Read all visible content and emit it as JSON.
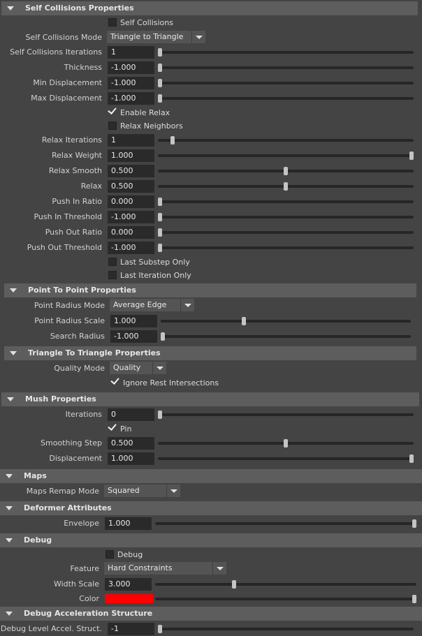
{
  "colors": {
    "accent_color": "#ff0000"
  },
  "sections": {
    "self_collisions": "Self Collisions Properties",
    "point_to_point": "Point To Point Properties",
    "tri_to_tri": "Triangle To Triangle Properties",
    "mush": "Mush Properties",
    "maps": "Maps",
    "deformer": "Deformer Attributes",
    "debug": "Debug",
    "debug_accel": "Debug Acceleration Structure"
  },
  "self_collisions": {
    "self_collisions_cb": {
      "label": "Self Collisions",
      "checked": false
    },
    "mode": {
      "label": "Self Collisions Mode",
      "value": "Triangle to Triangle"
    },
    "iterations": {
      "label": "Self Collisions Iterations",
      "value": "1",
      "slider": 0.0
    },
    "thickness": {
      "label": "Thickness",
      "value": "-1.000",
      "slider": 0.0
    },
    "min_displacement": {
      "label": "Min Displacement",
      "value": "-1.000",
      "slider": 0.0
    },
    "max_displacement": {
      "label": "Max Displacement",
      "value": "-1.000",
      "slider": 0.0
    },
    "enable_relax": {
      "label": "Enable Relax",
      "checked": true
    },
    "relax_neighbors": {
      "label": "Relax Neighbors",
      "checked": false
    },
    "relax_iterations": {
      "label": "Relax Iterations",
      "value": "1",
      "slider": 0.05
    },
    "relax_weight": {
      "label": "Relax Weight",
      "value": "1.000",
      "slider": 1.0
    },
    "relax_smooth": {
      "label": "Relax Smooth",
      "value": "0.500",
      "slider": 0.5
    },
    "relax": {
      "label": "Relax",
      "value": "0.500",
      "slider": 0.5
    },
    "push_in_ratio": {
      "label": "Push In Ratio",
      "value": "0.000",
      "slider": 0.0
    },
    "push_in_threshold": {
      "label": "Push In Threshold",
      "value": "-1.000",
      "slider": 0.0
    },
    "push_out_ratio": {
      "label": "Push Out Ratio",
      "value": "0.000",
      "slider": 0.0
    },
    "push_out_threshold": {
      "label": "Push Out Threshold",
      "value": "-1.000",
      "slider": 0.0
    },
    "last_substep_only": {
      "label": "Last Substep Only",
      "checked": false
    },
    "last_iteration_only": {
      "label": "Last Iteration Only",
      "checked": false
    }
  },
  "point_to_point": {
    "radius_mode": {
      "label": "Point Radius Mode",
      "value": "Average Edge"
    },
    "radius_scale": {
      "label": "Point Radius Scale",
      "value": "1.000",
      "slider": 0.33
    },
    "search_radius": {
      "label": "Search Radius",
      "value": "-1.000",
      "slider": 0.0
    }
  },
  "tri_to_tri": {
    "quality_mode": {
      "label": "Quality Mode",
      "value": "Quality"
    },
    "ignore_rest": {
      "label": "Ignore Rest Intersections",
      "checked": true
    }
  },
  "mush": {
    "iterations": {
      "label": "Iterations",
      "value": "0",
      "slider": 0.0
    },
    "pin": {
      "label": "Pin",
      "checked": true
    },
    "smoothing_step": {
      "label": "Smoothing Step",
      "value": "0.500",
      "slider": 0.5
    },
    "displacement": {
      "label": "Displacement",
      "value": "1.000",
      "slider": 1.0
    }
  },
  "maps": {
    "remap_mode": {
      "label": "Maps Remap Mode",
      "value": "Squared"
    }
  },
  "deformer": {
    "envelope": {
      "label": "Envelope",
      "value": "1.000",
      "slider": 1.0
    }
  },
  "debug": {
    "debug_cb": {
      "label": "Debug",
      "checked": false
    },
    "feature": {
      "label": "Feature",
      "value": "Hard Constraints"
    },
    "width_scale": {
      "label": "Width Scale",
      "value": "3.000",
      "slider": 0.3
    },
    "color": {
      "label": "Color",
      "value": "#ff0000",
      "slider": 1.0
    }
  },
  "debug_accel": {
    "level": {
      "label": "Debug Level Accel. Struct.",
      "value": "-1",
      "slider": 0.0
    }
  }
}
